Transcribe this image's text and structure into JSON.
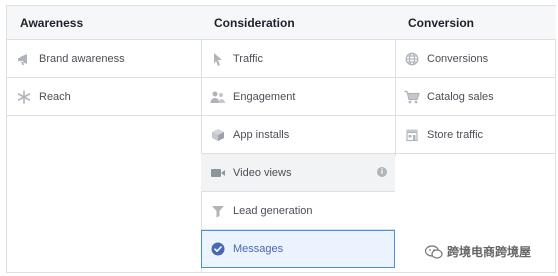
{
  "columns": [
    {
      "title": "Awareness",
      "items": [
        {
          "label": "Brand awareness",
          "icon": "megaphone-icon"
        },
        {
          "label": "Reach",
          "icon": "asterisk-icon"
        }
      ]
    },
    {
      "title": "Consideration",
      "items": [
        {
          "label": "Traffic",
          "icon": "cursor-icon"
        },
        {
          "label": "Engagement",
          "icon": "people-icon"
        },
        {
          "label": "App installs",
          "icon": "cube-icon"
        },
        {
          "label": "Video views",
          "icon": "video-camera-icon"
        },
        {
          "label": "Lead generation",
          "icon": "funnel-icon"
        },
        {
          "label": "Messages",
          "icon": "checkmark-circle-icon"
        }
      ]
    },
    {
      "title": "Conversion",
      "items": [
        {
          "label": "Conversions",
          "icon": "globe-icon"
        },
        {
          "label": "Catalog sales",
          "icon": "shopping-cart-icon"
        },
        {
          "label": "Store traffic",
          "icon": "store-icon"
        }
      ]
    }
  ],
  "states": {
    "hovered_item": "Video views",
    "selected_item": "Messages",
    "info_icon_symbol": "i"
  },
  "colors": {
    "border": "#dddfe2",
    "header_bg": "#f6f7f9",
    "icon_gray": "#b0b4bb",
    "selected_bg": "#ebf3ff",
    "selected_border": "#4a90e2",
    "selected_icon": "#4a67b1"
  },
  "watermark": {
    "text": "跨境电商跨境屋",
    "icon": "wechat-icon"
  }
}
